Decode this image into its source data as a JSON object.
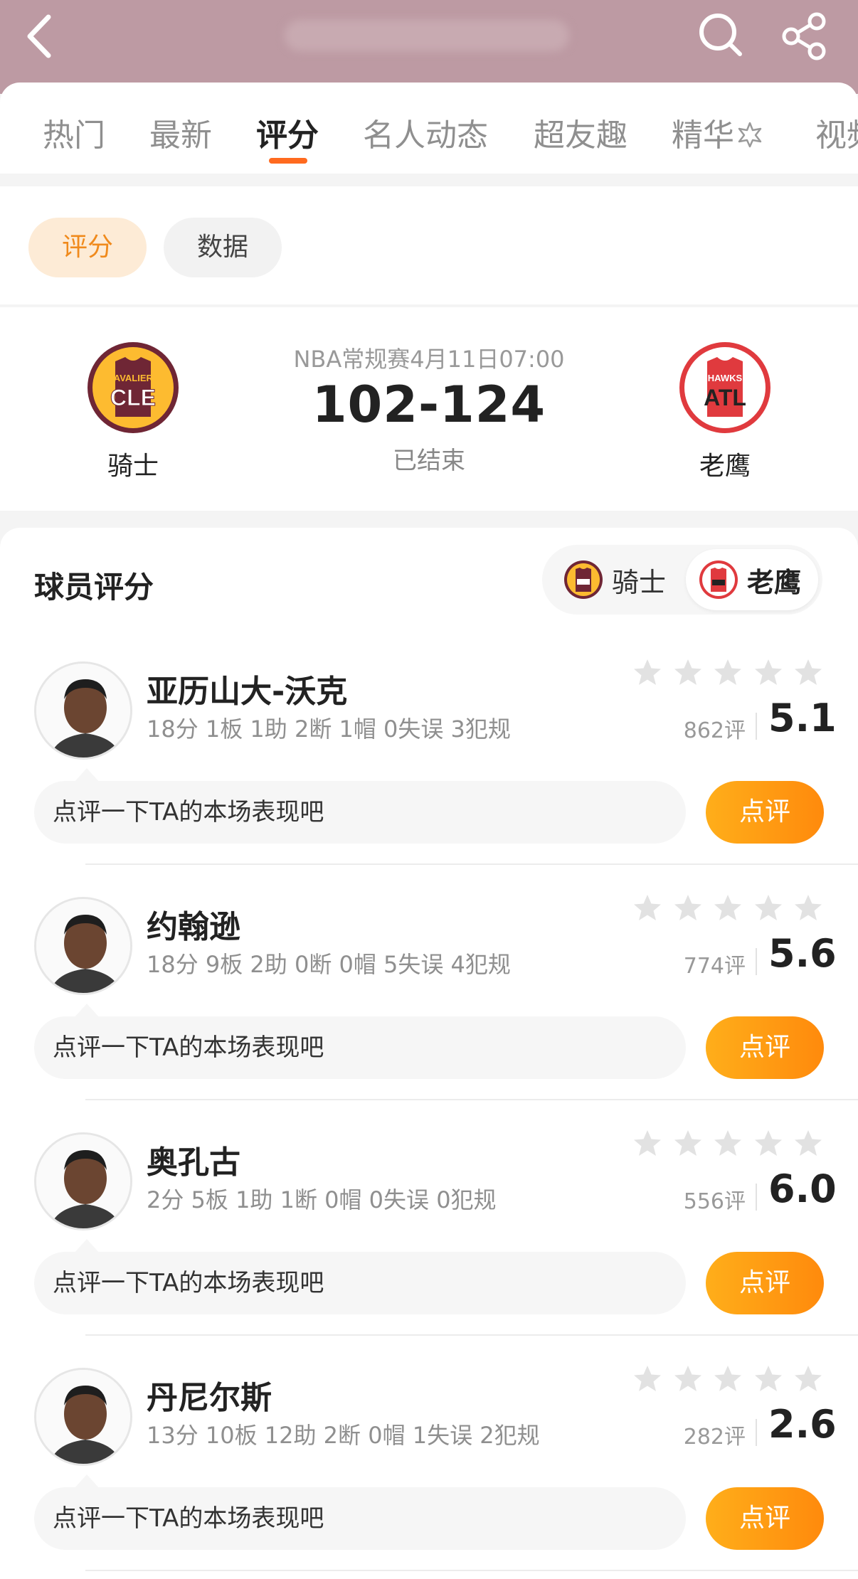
{
  "colors": {
    "accent": "#ff6a1f",
    "button": "#ff9a12",
    "header_bg": "#bd9aa3",
    "star_empty": "#e2e2e2"
  },
  "tabs": [
    {
      "label": "热门"
    },
    {
      "label": "最新"
    },
    {
      "label": "评分"
    },
    {
      "label": "名人动态"
    },
    {
      "label": "超友趣"
    },
    {
      "label": "精华"
    },
    {
      "label": "视频"
    }
  ],
  "filter": {
    "rating_label": "评分",
    "data_label": "数据"
  },
  "match": {
    "home": {
      "name": "骑士",
      "abbr": "CLE",
      "wordmark": "CAVALIERS"
    },
    "away": {
      "name": "老鹰",
      "abbr": "ATL",
      "wordmark": "HAWKS"
    },
    "info": "NBA常规赛4月11日07:00",
    "score": "102-124",
    "status": "已结束"
  },
  "section": {
    "title": "球员评分",
    "team_a": "骑士",
    "team_b": "老鹰"
  },
  "players": [
    {
      "name": "亚历山大-沃克",
      "stats": "18分 1板 1助 2断 1帽 0失误 3犯规",
      "count": "862评",
      "score": "5.1",
      "comment_placeholder": "点评一下TA的本场表现吧",
      "button": "点评"
    },
    {
      "name": "约翰逊",
      "stats": "18分 9板 2助 0断 0帽 5失误 4犯规",
      "count": "774评",
      "score": "5.6",
      "comment_placeholder": "点评一下TA的本场表现吧",
      "button": "点评"
    },
    {
      "name": "奥孔古",
      "stats": "2分 5板 1助 1断 0帽 0失误 0犯规",
      "count": "556评",
      "score": "6.0",
      "comment_placeholder": "点评一下TA的本场表现吧",
      "button": "点评"
    },
    {
      "name": "丹尼尔斯",
      "stats": "13分 10板 12助 2断 0帽 1失误 2犯规",
      "count": "282评",
      "score": "2.6",
      "comment_placeholder": "点评一下TA的本场表现吧",
      "button": "点评"
    }
  ]
}
